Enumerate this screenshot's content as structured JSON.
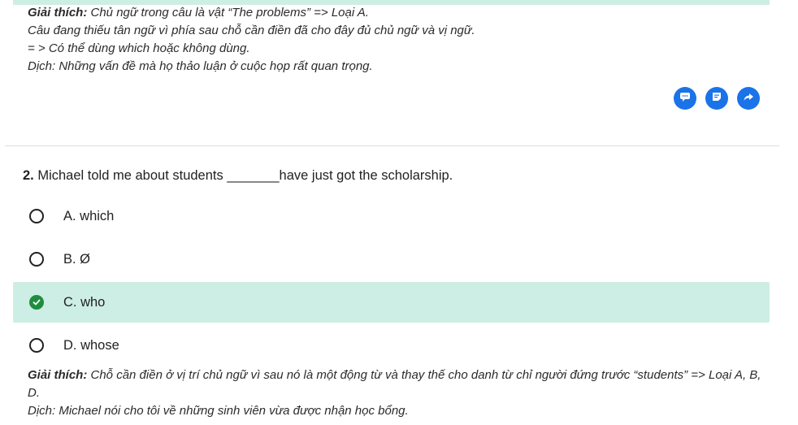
{
  "colors": {
    "accent": "#1a73e8",
    "correct_bg": "#cdeee4",
    "correct_icon": "#1e8e3e"
  },
  "explanation1": {
    "title": "Giải thích:",
    "text": " Chủ ngữ trong câu là vật “The problems” => Loại A.",
    "line2": "Câu đang thiếu tân ngữ vì phía sau chỗ cần điền đã cho đây đủ chủ ngữ và vị ngữ.",
    "line3": "= > Có thể dùng which hoặc không dùng.",
    "line4": "Dịch: Những vấn đề mà họ thảo luận ở cuộc họp rất quan trọng."
  },
  "actions": [
    {
      "icon": "comment-icon"
    },
    {
      "icon": "note-icon"
    },
    {
      "icon": "share-icon"
    }
  ],
  "question": {
    "number": "2.",
    "text": " Michael told me about students _______have just got the scholarship."
  },
  "options": [
    {
      "label": "A. which",
      "state": "unselected"
    },
    {
      "label": "B. Ø",
      "state": "unselected"
    },
    {
      "label": "C. who",
      "state": "correct"
    },
    {
      "label": "D. whose",
      "state": "unselected"
    }
  ],
  "explanation2": {
    "title": "Giải thích:",
    "text": " Chỗ cần điền ở vị trí chủ ngữ vì sau nó là một động từ và thay thế cho danh từ chỉ người đứng trước “students” => Loại A, B, D.",
    "line2": "Dịch: Michael nói cho tôi về những sinh viên vừa được nhận học bổng."
  }
}
